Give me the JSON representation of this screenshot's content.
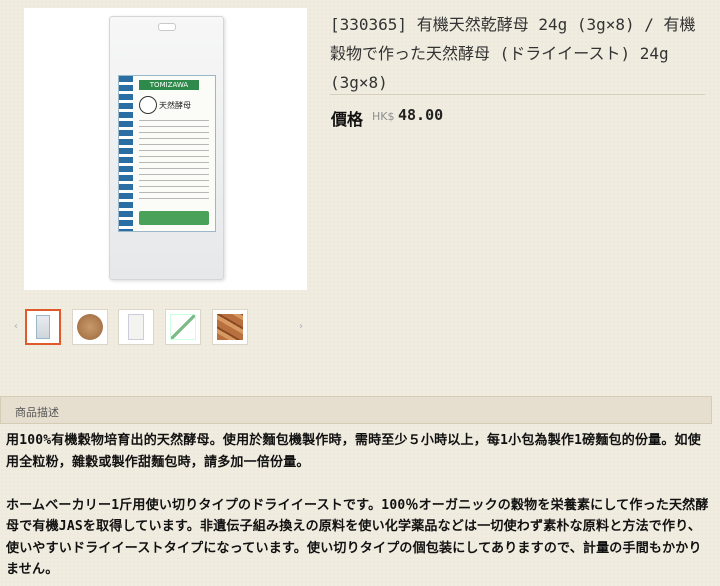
{
  "product": {
    "title": "[330365] 有機天然乾酵母 24g (3g×8) / 有機穀物で作った天然酵母 (ドライイースト) 24g (3g×8)",
    "price_label": "價格",
    "currency": "HK$",
    "price": "48.00",
    "package_brand_text": "TOMIZAWA",
    "package_name_text": "天然酵母"
  },
  "gallery": {
    "prev_arrow": "‹",
    "next_arrow": "›",
    "thumbnails": [
      {
        "name": "packet-front",
        "active": true
      },
      {
        "name": "yeast-powder",
        "active": false
      },
      {
        "name": "packet-back",
        "active": false
      },
      {
        "name": "sachets",
        "active": false
      },
      {
        "name": "bread",
        "active": false
      }
    ]
  },
  "description": {
    "header": "商品描述",
    "paragraph_zh": "用100%有機穀物培育出的天然酵母。使用於麵包機製作時，需時至少５小時以上，每1小包為製作1磅麵包的份量。如使用全粒粉，雜穀或製作甜麵包時，請多加一倍份量。",
    "paragraph_ja": "ホームベーカリー1斤用使い切りタイプのドライイーストです。100％オーガニックの穀物を栄養素にして作った天然酵母で有機JASを取得しています。非遺伝子組み換えの原料を使い化学薬品などは一切使わず素朴な原料と方法で作り、使いやすいドライイーストタイプになっています。使い切りタイプの個包装にしてありますので、計量の手間もかかりません。"
  },
  "colors": {
    "background": "#f1ece0",
    "active_thumb_border": "#e05a2b",
    "header_band": "#e6dfcf"
  }
}
